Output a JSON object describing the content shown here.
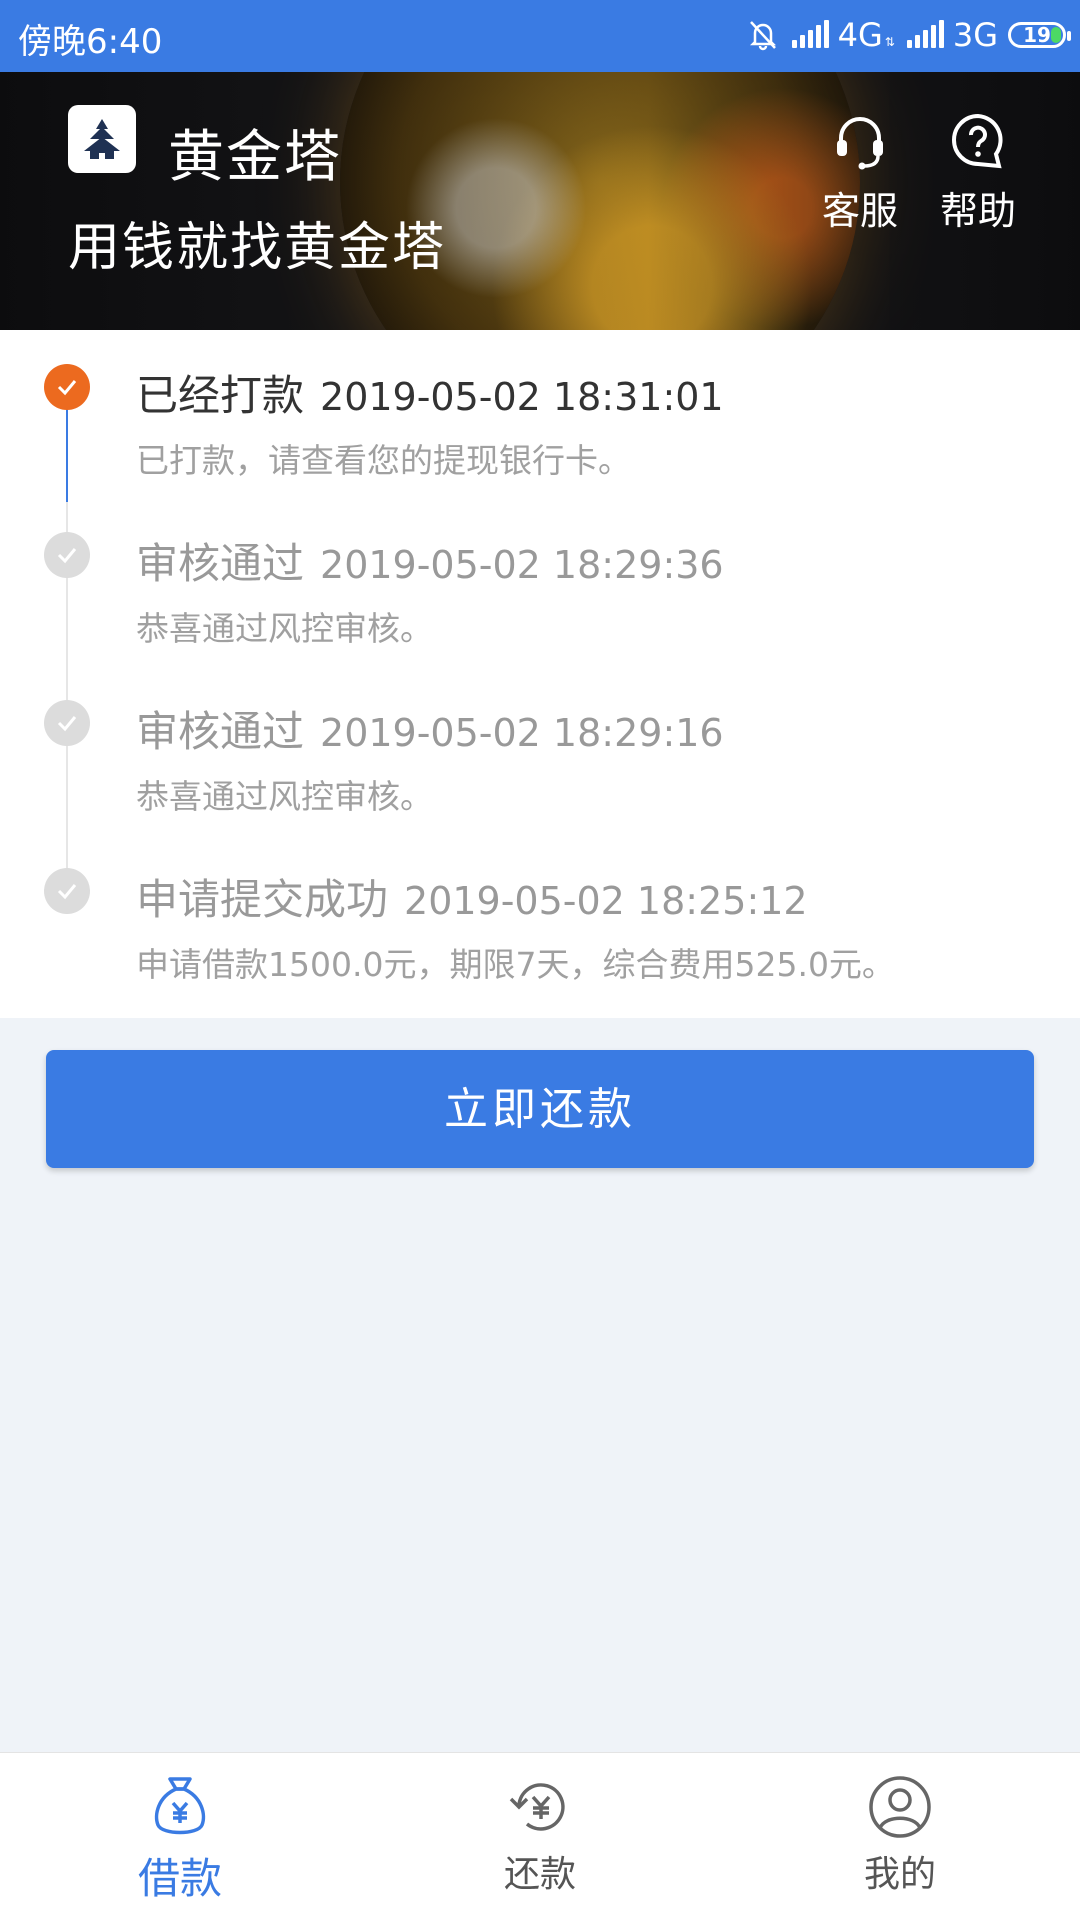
{
  "status_bar": {
    "time": "傍晚6:40",
    "network1": "4G",
    "network2": "3G",
    "battery": "19"
  },
  "header": {
    "app_name": "黄金塔",
    "slogan": "用钱就找黄金塔",
    "customer_service_label": "客服",
    "help_label": "帮助"
  },
  "timeline": [
    {
      "title": "已经打款",
      "datetime": "2019-05-02 18:31:01",
      "desc": "已打款，请查看您的提现银行卡。",
      "active": true
    },
    {
      "title": "审核通过",
      "datetime": "2019-05-02 18:29:36",
      "desc": "恭喜通过风控审核。",
      "active": false
    },
    {
      "title": "审核通过",
      "datetime": "2019-05-02 18:29:16",
      "desc": "恭喜通过风控审核。",
      "active": false
    },
    {
      "title": "申请提交成功",
      "datetime": "2019-05-02 18:25:12",
      "desc": "申请借款1500.0元，期限7天，综合费用525.0元。",
      "active": false
    }
  ],
  "actions": {
    "repay_now_label": "立即还款"
  },
  "bottom_nav": {
    "borrow_label": "借款",
    "repay_label": "还款",
    "mine_label": "我的",
    "active": "借款"
  },
  "colors": {
    "primary": "#3a7be3",
    "active_step": "#ec6a1f",
    "inactive_step": "#dcdcdc",
    "page_bg": "#eff3f8"
  },
  "icons": {
    "logo": "pagoda-logo-icon",
    "customer_service": "headset-icon",
    "help": "question-bubble-icon",
    "step_done": "check-icon",
    "borrow": "money-bag-icon",
    "repay": "yuan-refresh-icon",
    "mine": "user-circle-icon"
  }
}
